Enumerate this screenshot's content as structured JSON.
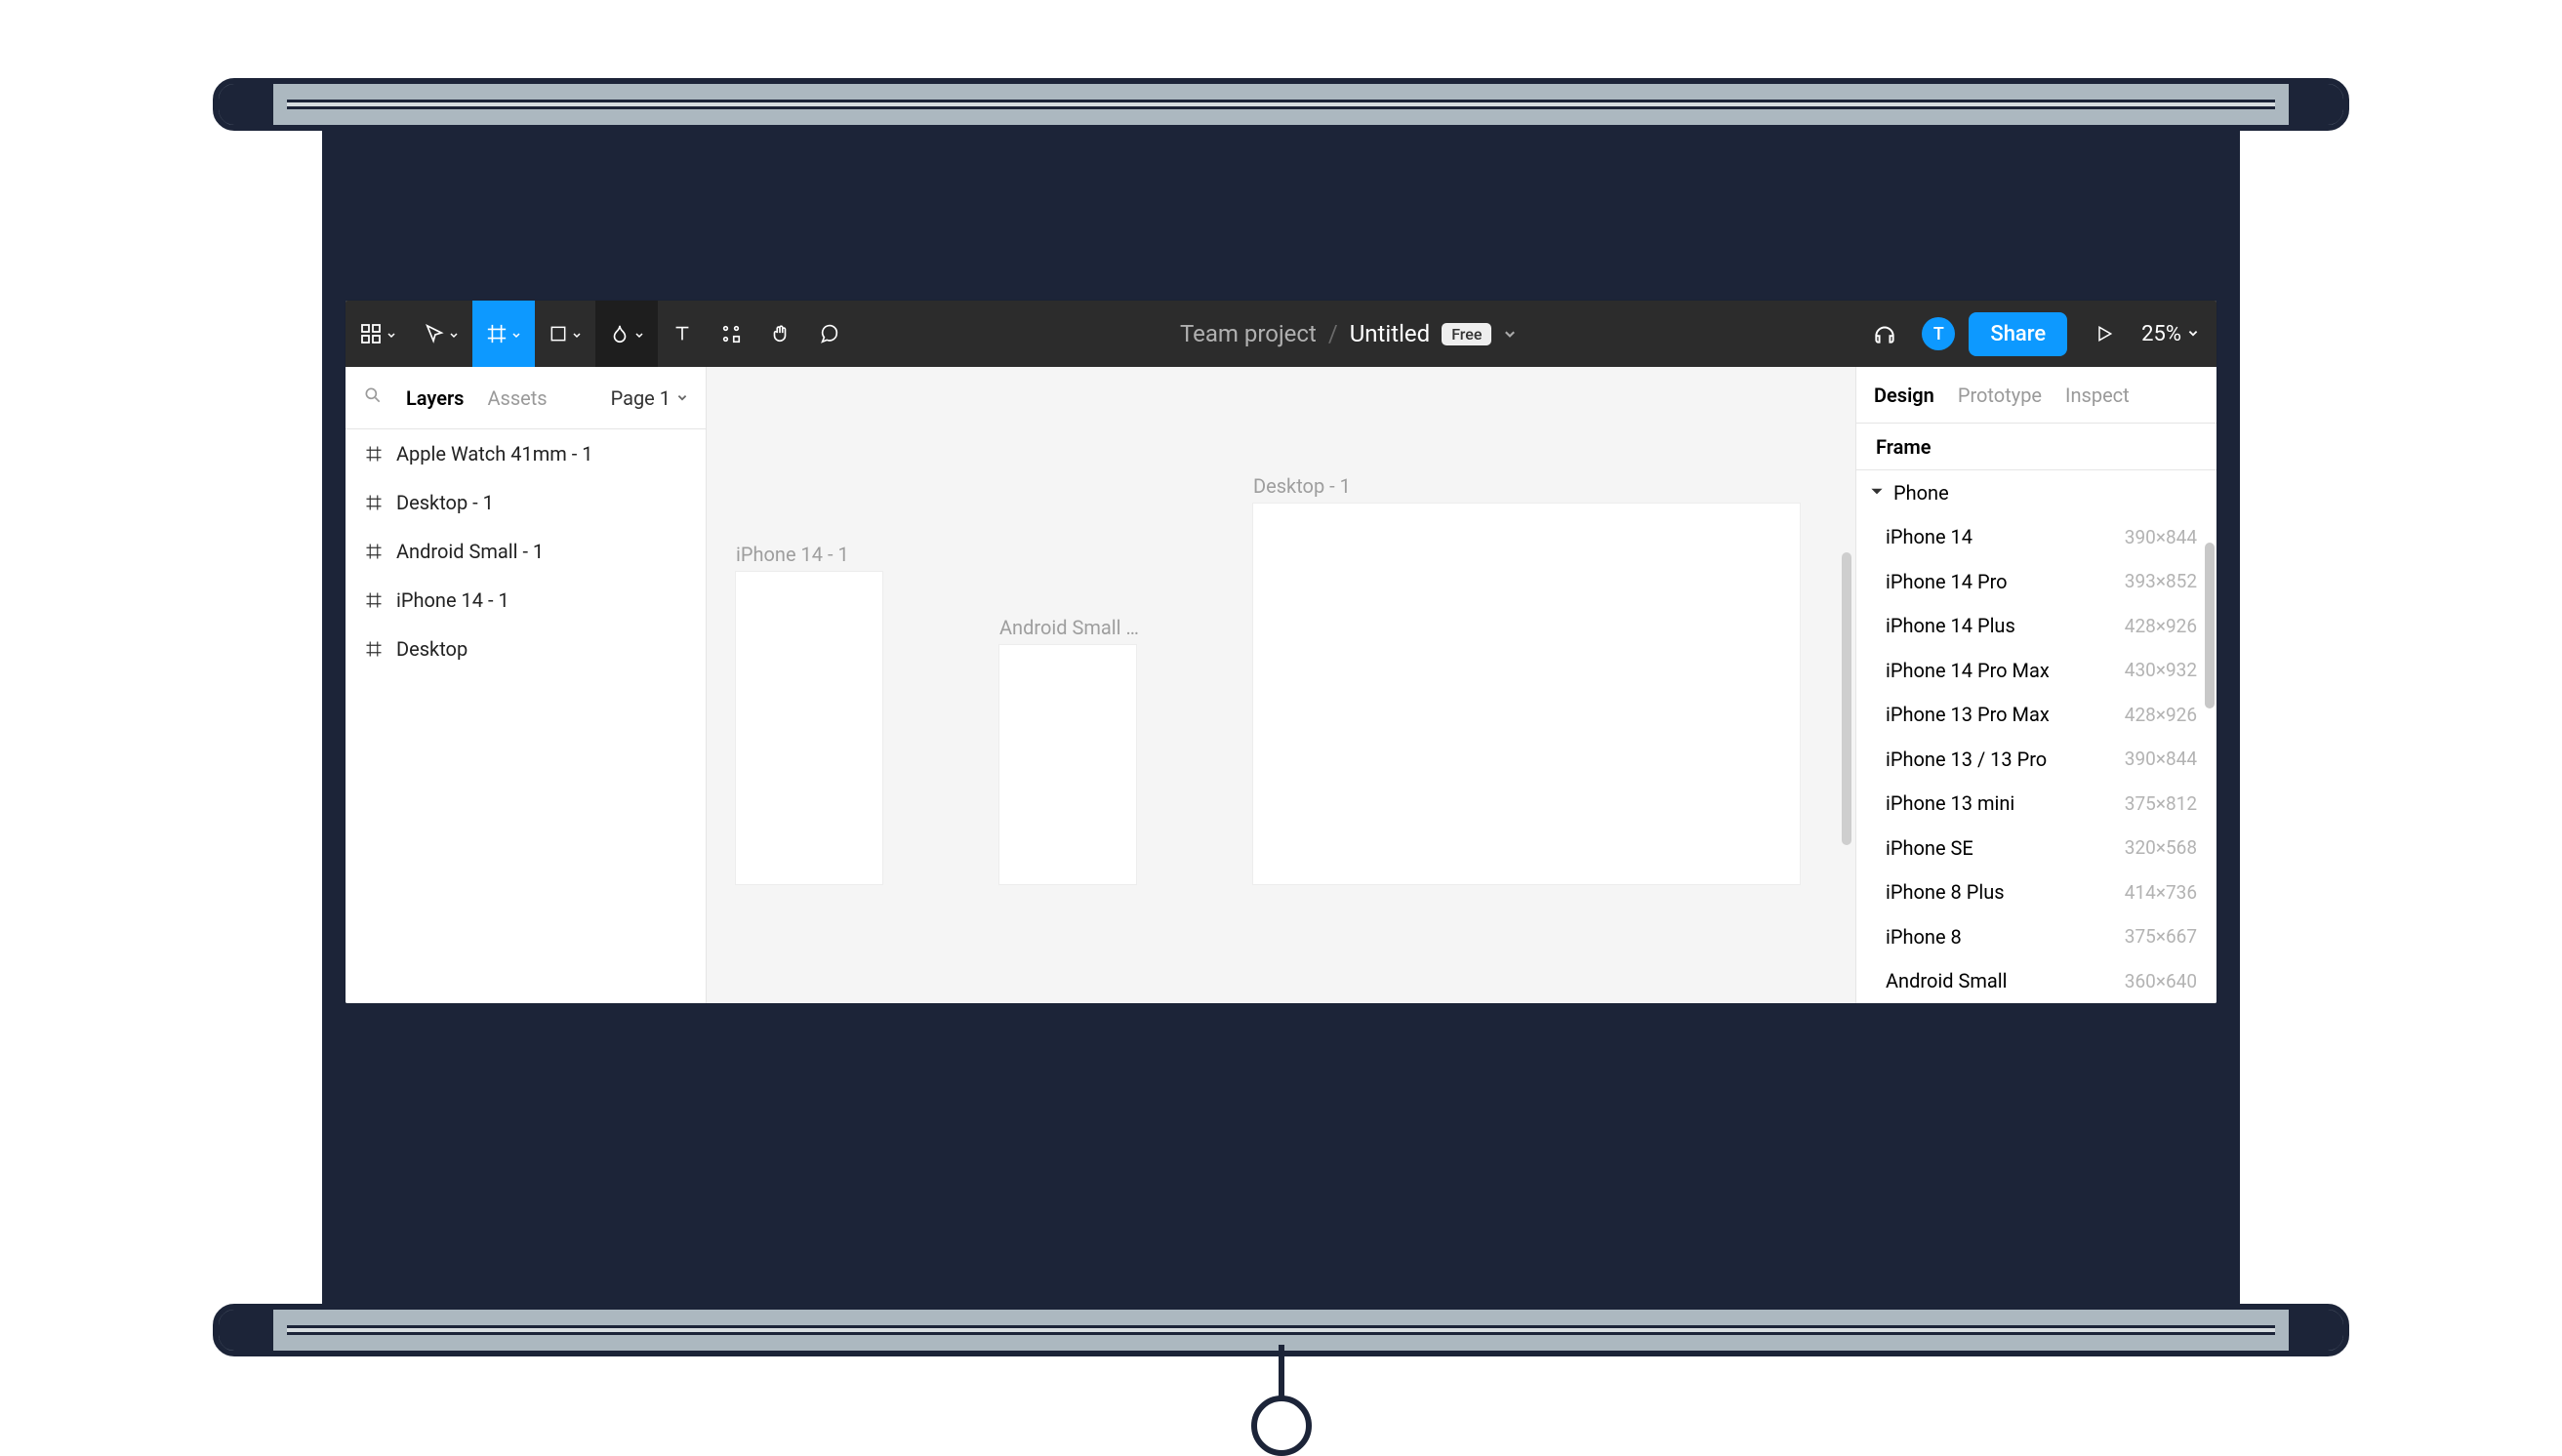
{
  "toolbar": {
    "project": "Team project",
    "file": "Untitled",
    "badge": "Free",
    "share": "Share",
    "zoom": "25%",
    "avatar": "T"
  },
  "left_panel": {
    "tabs": {
      "layers": "Layers",
      "assets": "Assets"
    },
    "page": "Page 1",
    "layers": [
      "Apple Watch 41mm - 1",
      "Desktop - 1",
      "Android Small - 1",
      "iPhone 14 - 1",
      "Desktop"
    ]
  },
  "right_panel": {
    "tabs": {
      "design": "Design",
      "prototype": "Prototype",
      "inspect": "Inspect"
    },
    "section": "Frame",
    "category": "Phone",
    "presets": [
      {
        "name": "iPhone 14",
        "dim": "390×844"
      },
      {
        "name": "iPhone 14 Pro",
        "dim": "393×852"
      },
      {
        "name": "iPhone 14 Plus",
        "dim": "428×926"
      },
      {
        "name": "iPhone 14 Pro Max",
        "dim": "430×932"
      },
      {
        "name": "iPhone 13 Pro Max",
        "dim": "428×926"
      },
      {
        "name": "iPhone 13 / 13 Pro",
        "dim": "390×844"
      },
      {
        "name": "iPhone 13 mini",
        "dim": "375×812"
      },
      {
        "name": "iPhone SE",
        "dim": "320×568"
      },
      {
        "name": "iPhone 8 Plus",
        "dim": "414×736"
      },
      {
        "name": "iPhone 8",
        "dim": "375×667"
      },
      {
        "name": "Android Small",
        "dim": "360×640"
      }
    ]
  },
  "canvas": {
    "frames": {
      "iphone": "iPhone 14 - 1",
      "android": "Android Small …",
      "desktop": "Desktop - 1"
    }
  }
}
